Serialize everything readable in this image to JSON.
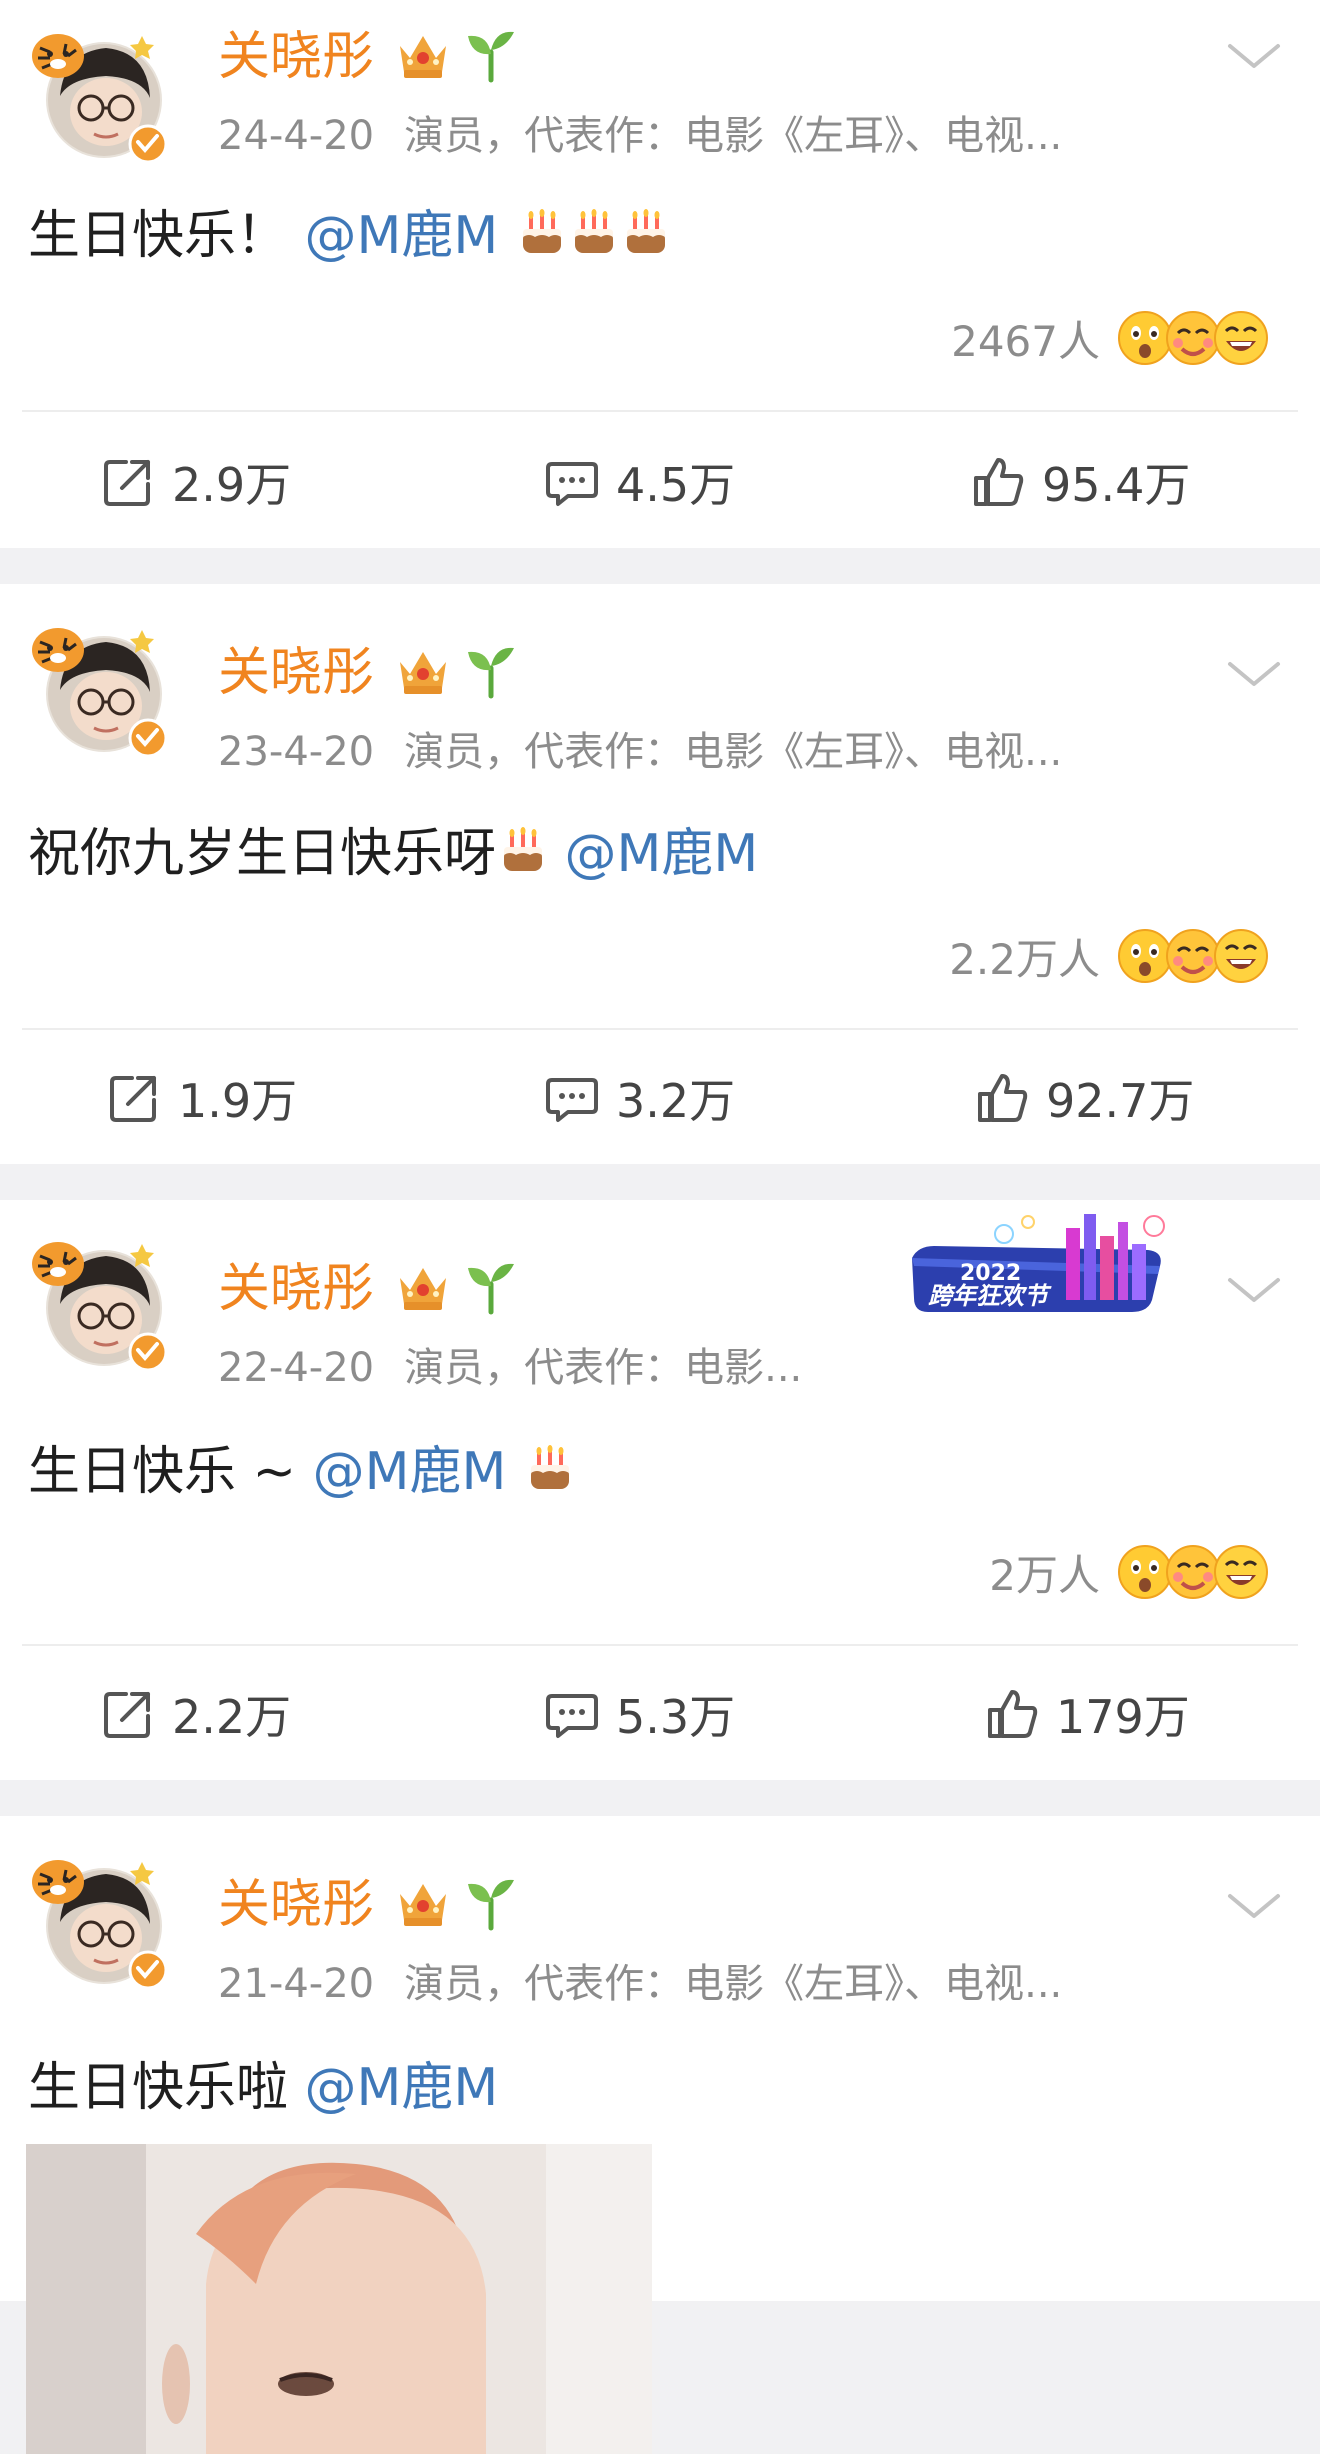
{
  "colors": {
    "username": "#f0841f",
    "mention": "#3f78b8",
    "meta": "#8c8c8c",
    "background": "#f1f1f3"
  },
  "posts": [
    {
      "username": "关晓彤",
      "date": "24-4-20",
      "bio": "演员，代表作：电影《左耳》、电视...",
      "text": "生日快乐！",
      "mention": "@M鹿M",
      "cakes": 3,
      "reactions_count": "2467人",
      "share": "2.9万",
      "comment": "4.5万",
      "like": "95.4万",
      "icons": [
        "avatar",
        "crown-badge-icon",
        "sprout-badge-icon",
        "chevron-down-icon"
      ]
    },
    {
      "username": "关晓彤",
      "date": "23-4-20",
      "bio": "演员，代表作：电影《左耳》、电视...",
      "text": "祝你九岁生日快乐呀",
      "mention": "@M鹿M",
      "cakes": 1,
      "reactions_count": "2.2万人",
      "share": "1.9万",
      "comment": "3.2万",
      "like": "92.7万"
    },
    {
      "username": "关晓彤",
      "date": "22-4-20",
      "bio": "演员，代表作：电影...",
      "text": "生日快乐 ~",
      "mention": "@M鹿M",
      "cakes": 1,
      "reactions_count": "2万人",
      "share": "2.2万",
      "comment": "5.3万",
      "like": "179万",
      "banner": {
        "year": "2022",
        "title": "跨年狂欢节"
      }
    },
    {
      "username": "关晓彤",
      "date": "21-4-20",
      "bio": "演员，代表作：电影《左耳》、电视...",
      "text": "生日快乐啦",
      "mention": "@M鹿M",
      "cakes": 0,
      "has_photo": true
    }
  ]
}
